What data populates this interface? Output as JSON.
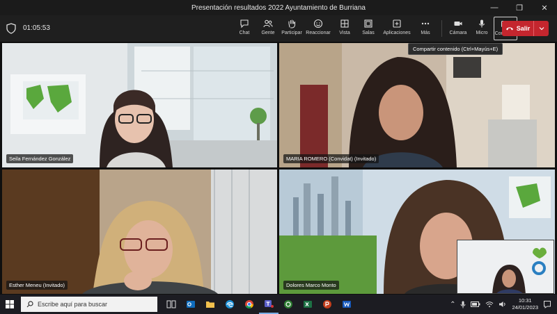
{
  "window": {
    "title": "Presentación resultados 2022 Ayuntamiento de Burriana"
  },
  "toolbar": {
    "timer": "01:05:53",
    "items": [
      {
        "label": "Chat"
      },
      {
        "label": "Gente"
      },
      {
        "label": "Participar"
      },
      {
        "label": "Reaccionar"
      },
      {
        "label": "Vista"
      },
      {
        "label": "Salas"
      },
      {
        "label": "Aplicaciones"
      },
      {
        "label": "Más"
      },
      {
        "label": "Cámara"
      },
      {
        "label": "Micro"
      },
      {
        "label": "Compartir"
      }
    ],
    "leave_label": "Salir",
    "tooltip": "Compartir contenido (Ctrl+Mayús+E)"
  },
  "participants": [
    {
      "name": "Seila Fernández González"
    },
    {
      "name": "MARIA ROMERO (Convidat) (Invitado)"
    },
    {
      "name": "Esther Meneu (Invitado)"
    },
    {
      "name": "Dolores Marco Monto"
    }
  ],
  "taskbar": {
    "search_placeholder": "Escribe aquí para buscar",
    "time": "10:31",
    "date": "24/01/2023"
  },
  "colors": {
    "leave": "#c4262e",
    "toolbar": "#1f1f1f",
    "taskbar": "#1c1c22"
  }
}
